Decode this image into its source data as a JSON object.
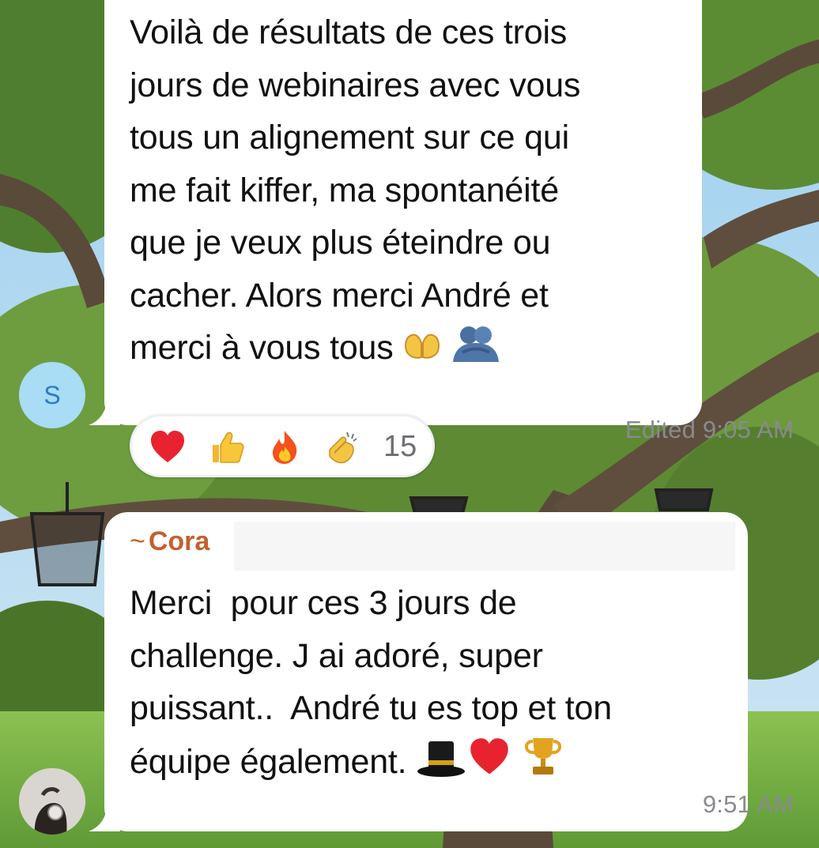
{
  "chat": {
    "messages": [
      {
        "lines": [
          "Voilà de résultats de ces trois",
          "jours de webinaires avec vous",
          "tous un alignement sur ce qui",
          "me fait kiffer, ma spontanéité",
          "que je veux plus éteindre ou",
          "cacher. Alors merci André et",
          "merci à vous tous"
        ],
        "trailing_emoji": [
          "heart-hands",
          "people-hugging"
        ],
        "edited_label": "Edited",
        "time": "9:05 AM",
        "avatar_initial": "S",
        "avatar_color": "#a9dcf5",
        "reactions": {
          "emojis": [
            "red-heart",
            "thumbs-up",
            "fire",
            "clapping-hands"
          ],
          "count": "15"
        }
      },
      {
        "sender_prefix": "~",
        "sender": "Cora",
        "sender_color": "#c4602f",
        "lines": [
          "Merci  pour ces 3 jours de",
          "challenge. J ai adoré, super",
          "puissant..  André tu es top et ton",
          "équipe également."
        ],
        "trailing_emoji": [
          "top-hat",
          "red-heart",
          "trophy"
        ],
        "time": "9:51 AM",
        "avatar": "user-photo"
      }
    ]
  }
}
